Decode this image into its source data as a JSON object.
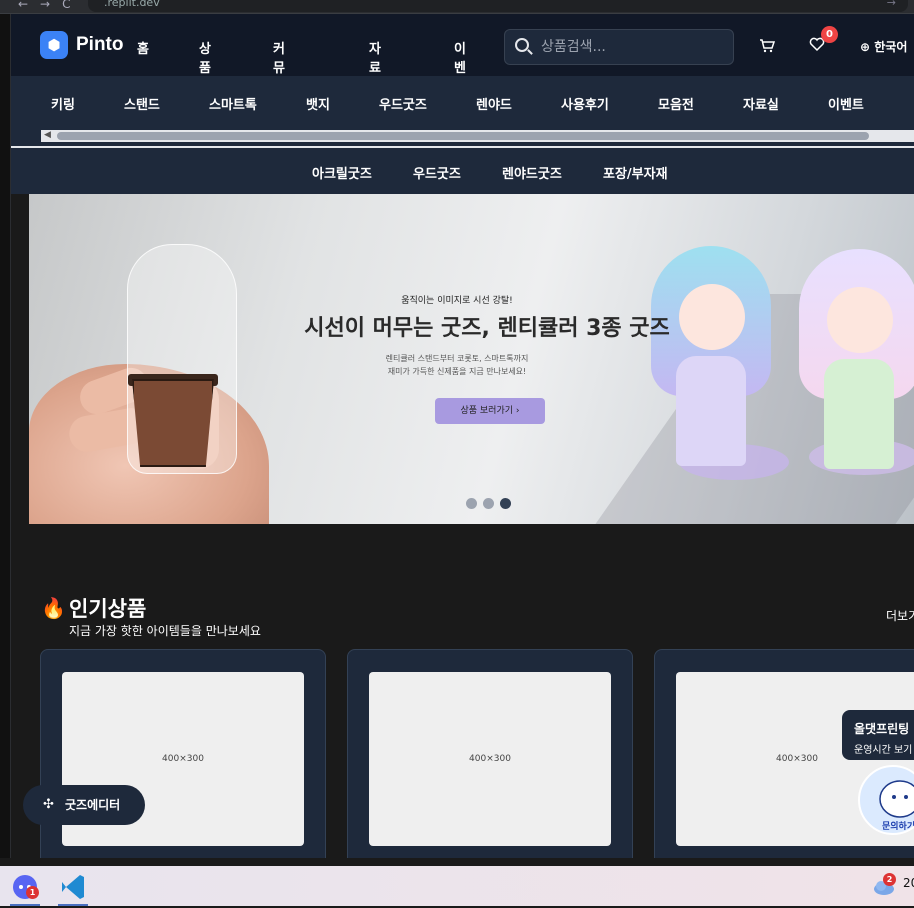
{
  "browser": {
    "url": ".replit.dev"
  },
  "header": {
    "logo_text": "Pinto",
    "nav": [
      "홈",
      "상품",
      "커뮤니티",
      "자료실",
      "이벤트"
    ],
    "search_placeholder": "상품검색...",
    "wishlist_count": "0",
    "language": "한국어"
  },
  "categories": [
    "키링",
    "스탠드",
    "스마트톡",
    "뱃지",
    "우드굿즈",
    "렌야드",
    "사용후기",
    "모음전",
    "자료실",
    "이벤트"
  ],
  "subcategories": [
    "아크릴굿즈",
    "우드굿즈",
    "렌야드굿즈",
    "포장/부자재"
  ],
  "hero": {
    "subtitle": "움직이는 이미지로 시선 강탈!",
    "title": "시선이 머무는 굿즈, 렌티큘러 3종 굿즈",
    "desc_line1": "렌티큘러 스탠드부터 코롯토, 스마트톡까지",
    "desc_line2": "재미가 가득한 신제품을 지금 만나보세요!",
    "button": "상품 보러가기  ›",
    "active_slide": 3,
    "slide_count": 3
  },
  "popular": {
    "title": "인기상품",
    "subtitle": "지금 가장 핫한 아이템들을 만나보세요",
    "more": "더보기",
    "cards": [
      {
        "image_label": "400×300"
      },
      {
        "image_label": "400×300"
      },
      {
        "image_label": "400×300"
      }
    ]
  },
  "floating": {
    "editor_button": "굿즈에디터",
    "chat_title": "올댓프린팅",
    "chat_hours": "운영시간 보기",
    "chat_label": "문의하기"
  },
  "taskbar": {
    "discord_badge": "1",
    "weather_badge": "2",
    "clock": "20"
  },
  "colors": {
    "header_bg": "#111827",
    "nav_bg": "#1e293b",
    "accent": "#3b82f6",
    "badge": "#ef4444",
    "hero_button": "#a89ae0"
  }
}
